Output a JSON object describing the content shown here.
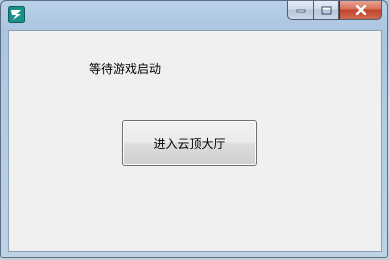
{
  "window": {
    "title": "",
    "icon": "app-logo-icon",
    "caption_buttons": [
      "minimize-icon",
      "maximize-icon",
      "close-icon"
    ]
  },
  "main": {
    "status_text": "等待游戏启动",
    "enter_button_label": "进入云顶大厅"
  }
}
